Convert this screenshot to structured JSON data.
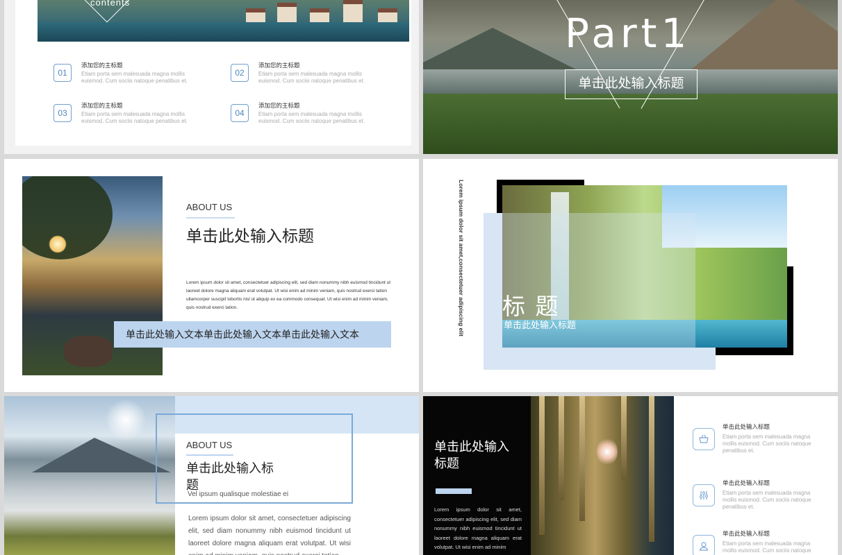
{
  "slide1": {
    "contents_label": "contents",
    "items": [
      {
        "num": "01",
        "title": "添加您的主标题",
        "desc": "Etiam porta sem malesuada magna mollis euismod. Cum sociis natoque penatibus et."
      },
      {
        "num": "02",
        "title": "添加您的主标题",
        "desc": "Etiam porta sem malesuada magna mollis euismod. Cum sociis natoque penatibus et."
      },
      {
        "num": "03",
        "title": "添加您的主标题",
        "desc": "Etiam porta sem malesuada magna mollis euismod. Cum sociis natoque penatibus et."
      },
      {
        "num": "04",
        "title": "添加您的主标题",
        "desc": "Etiam porta sem malesuada magna mollis euismod. Cum sociis natoque penatibus et."
      }
    ]
  },
  "slide2": {
    "heading": "Part1",
    "subtitle": "单击此处输入标题"
  },
  "slide3": {
    "about": "ABOUT US",
    "title": "单击此处输入标题",
    "paragraph": "Lorem ipsum dolor sit amet, consectetuer adipiscing elit, sed diam nonummy nibh euismod tincidunt ut laoreet dolore magna aliquam erat volutpat. Ut wisi enim ad minim veniam, quis nostrud exerci tation ullamcorper suscipit lobortis nisl ut aliquip ex ea commodo consequat. Ut wisi enim ad minim veniam, quis nostrud exerci tation.",
    "band_text": "单击此处输入文本单击此处输入文本单击此处输入文本"
  },
  "slide4": {
    "vertical_text": "Lorem ipsum dolor sit amet,consectetuer adipiscing elit",
    "big_title": "标 题",
    "subtitle": "单击此处输入标题"
  },
  "slide5": {
    "about": "ABOUT US",
    "title": "单击此处输入标题",
    "tagline": "Vel ipsum qualisque molestiae ei",
    "paragraph": "Lorem ipsum dolor sit amet, consectetuer adipiscing elit, sed diam nonummy nibh euismod tincidunt ut laoreet dolore magna aliquam erat volutpat. Ut wisi enim ad minim veniam, quis nostrud exerci tation"
  },
  "slide6": {
    "title": "单击此处输入标题",
    "paragraph": "Lorem ipsum dolor sit amet, consectetuer adipiscing elit, sed diam nonummy nibh euismod tincidunt ut laoreet dolore magna aliquam erat volutpat. Ut wisi enim ad minim",
    "features": [
      {
        "icon": "basket-icon",
        "title": "单击此处输入标题",
        "desc": "Etiam porta sem malesuada magna mollis euismod. Cum sociis natoque penatibus et."
      },
      {
        "icon": "sliders-icon",
        "title": "单击此处输入标题",
        "desc": "Etiam porta sem malesuada magna mollis euismod. Cum sociis natoque penatibus et."
      },
      {
        "icon": "user-icon",
        "title": "单击此处输入标题",
        "desc": "Etiam porta sem malesuada magna mollis euismod. Cum sociis natoque"
      }
    ]
  },
  "colors": {
    "accent_blue": "#6d9fd0",
    "light_blue": "#bcd4ee",
    "dark": "#060606"
  }
}
